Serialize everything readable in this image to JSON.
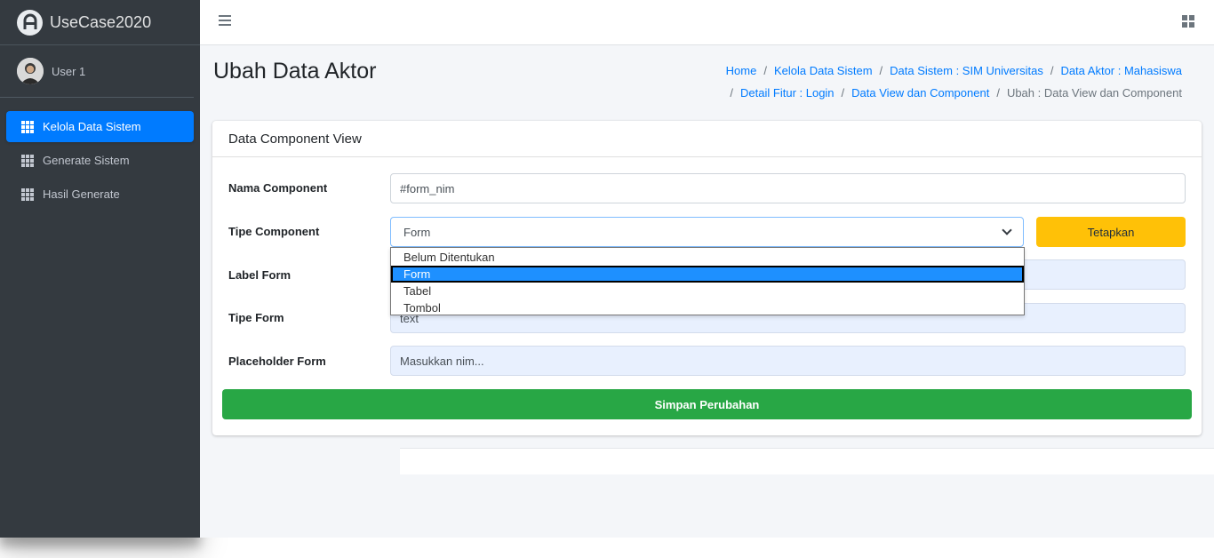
{
  "brand": {
    "name": "UseCase2020"
  },
  "user": {
    "name": "User 1"
  },
  "sidebar": {
    "items": [
      {
        "label": "Kelola Data Sistem",
        "icon": "grid-icon",
        "active": true
      },
      {
        "label": "Generate Sistem",
        "icon": "grid-icon",
        "active": false
      },
      {
        "label": "Hasil Generate",
        "icon": "grid-icon",
        "active": false
      }
    ]
  },
  "page": {
    "title": "Ubah Data Aktor"
  },
  "breadcrumb": {
    "items": [
      "Home",
      "Kelola Data Sistem",
      "Data Sistem : SIM Universitas",
      "Data Aktor : Mahasiswa",
      "Detail Fitur : Login",
      "Data View dan Component"
    ],
    "current": "Ubah : Data View dan Component",
    "separator": "/"
  },
  "card": {
    "title": "Data Component View",
    "fields": {
      "nama_component": {
        "label": "Nama Component",
        "value": "#form_nim"
      },
      "tipe_component": {
        "label": "Tipe Component",
        "value": "Form"
      },
      "label_form": {
        "label": "Label Form",
        "value": ""
      },
      "tipe_form": {
        "label": "Tipe Form",
        "value": "text"
      },
      "placeholder_form": {
        "label": "Placeholder Form",
        "value": "Masukkan nim..."
      }
    },
    "tetapkan_label": "Tetapkan",
    "submit_label": "Simpan Perubahan"
  },
  "dropdown": {
    "options": [
      "Belum Ditentukan",
      "Form",
      "Tabel",
      "Tombol"
    ],
    "selected": "Form"
  },
  "colors": {
    "sidebar_bg": "#343a40",
    "primary": "#007bff",
    "warning": "#ffc107",
    "success": "#28a745",
    "content_bg": "#f4f6f9"
  }
}
